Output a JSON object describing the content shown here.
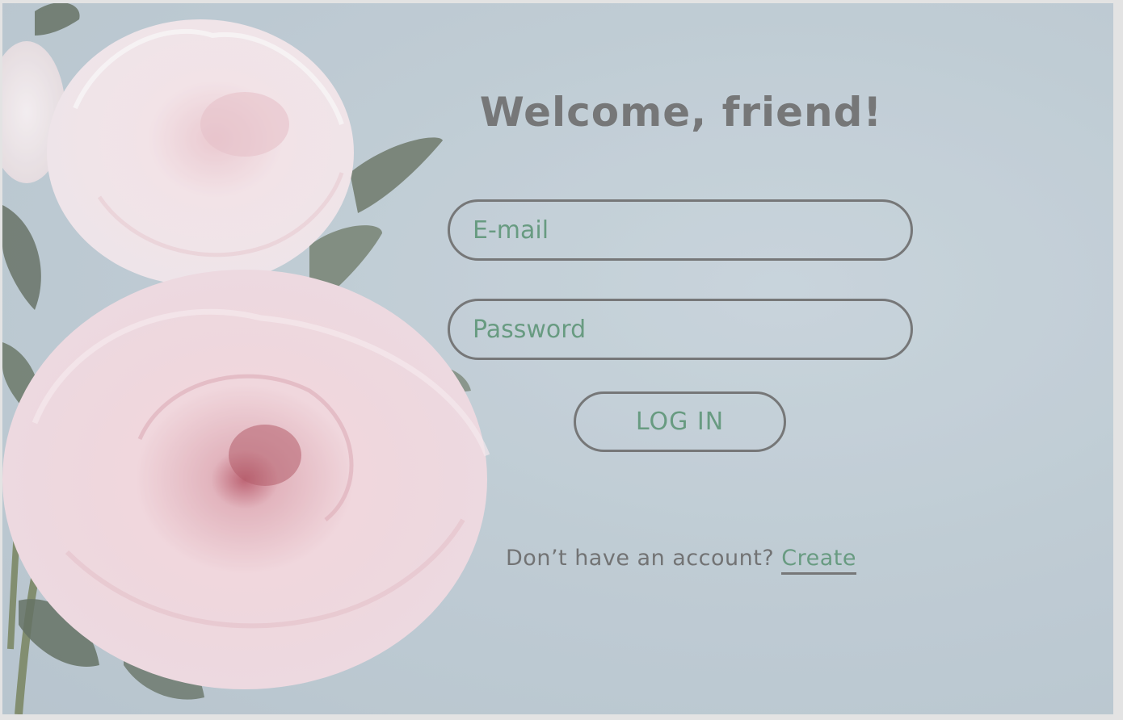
{
  "login": {
    "title": "Welcome, friend!",
    "email_placeholder": "E-mail",
    "password_placeholder": "Password",
    "login_label": "LOG IN",
    "signup_prompt": "Don’t have an account?",
    "signup_link": "Create"
  },
  "colors": {
    "background": "#b8c6cf",
    "text_gray": "#5f5f5f",
    "accent_green": "#4e8a6a",
    "petal_pink": "#f2cdd3"
  },
  "images": {
    "background": "pink-peony-flowers"
  }
}
